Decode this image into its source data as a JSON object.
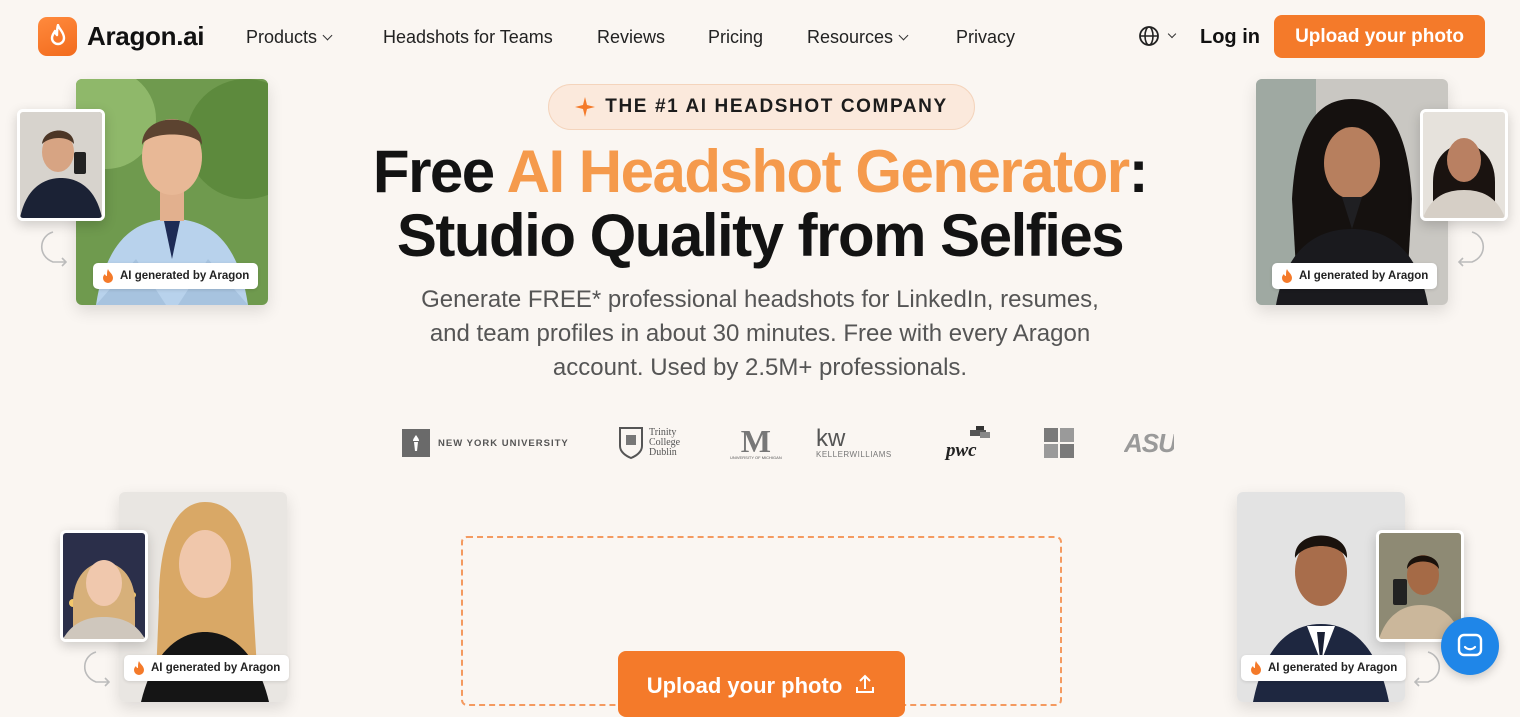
{
  "brand": {
    "name": "Aragon.ai"
  },
  "nav": {
    "products": "Products",
    "teams": "Headshots for Teams",
    "reviews": "Reviews",
    "pricing": "Pricing",
    "resources": "Resources",
    "privacy": "Privacy",
    "login": "Log in",
    "cta": "Upload your photo"
  },
  "hero": {
    "badge": "THE #1 AI HEADSHOT COMPANY",
    "title_part1": "Free ",
    "title_accent": "AI Headshot Generator",
    "title_part2": ":",
    "title_line2": "Studio Quality from Selfies",
    "subtitle": "Generate FREE* professional headshots for LinkedIn, resumes, and team profiles in about 30 minutes. Free with every Aragon account. Used by 2.5M+ professionals.",
    "cta": "Upload your photo"
  },
  "logos": {
    "nyu": "NEW YORK UNIVERSITY",
    "trinity1": "Trinity",
    "trinity2": "College",
    "trinity3": "Dublin",
    "michigan_m": "M",
    "michigan_txt": "UNIVERSITY OF MICHIGAN",
    "kw": "kw",
    "kw_txt": "KELLERWILLIAMS",
    "pwc": "pwc",
    "asu": "ASU"
  },
  "samples": {
    "tag": "AI generated by Aragon"
  },
  "colors": {
    "accent": "#f47a2a",
    "accent_text": "#f59a4c",
    "background": "#faf6f2",
    "chat": "#1f86e8"
  }
}
